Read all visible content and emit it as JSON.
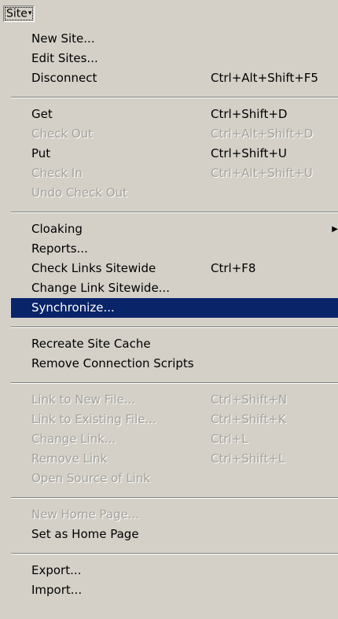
{
  "menu": {
    "title": "Site"
  },
  "items": [
    {
      "label": "New Site...",
      "shortcut": "",
      "enabled": true
    },
    {
      "label": "Edit Sites...",
      "shortcut": "",
      "enabled": true
    },
    {
      "label": "Disconnect",
      "shortcut": "Ctrl+Alt+Shift+F5",
      "enabled": true
    },
    {
      "label": "Get",
      "shortcut": "Ctrl+Shift+D",
      "enabled": true
    },
    {
      "label": "Check Out",
      "shortcut": "Ctrl+Alt+Shift+D",
      "enabled": false
    },
    {
      "label": "Put",
      "shortcut": "Ctrl+Shift+U",
      "enabled": true
    },
    {
      "label": "Check In",
      "shortcut": "Ctrl+Alt+Shift+U",
      "enabled": false
    },
    {
      "label": "Undo Check Out",
      "shortcut": "",
      "enabled": false
    },
    {
      "label": "Cloaking",
      "shortcut": "",
      "enabled": true,
      "submenu": true
    },
    {
      "label": "Reports...",
      "shortcut": "",
      "enabled": true
    },
    {
      "label": "Check Links Sitewide",
      "shortcut": "Ctrl+F8",
      "enabled": true
    },
    {
      "label": "Change Link Sitewide...",
      "shortcut": "",
      "enabled": true
    },
    {
      "label": "Synchronize...",
      "shortcut": "",
      "enabled": true,
      "selected": true
    },
    {
      "label": "Recreate Site Cache",
      "shortcut": "",
      "enabled": true
    },
    {
      "label": "Remove Connection Scripts",
      "shortcut": "",
      "enabled": true
    },
    {
      "label": "Link to New File...",
      "shortcut": "Ctrl+Shift+N",
      "enabled": false
    },
    {
      "label": "Link to Existing File...",
      "shortcut": "Ctrl+Shift+K",
      "enabled": false
    },
    {
      "label": "Change Link...",
      "shortcut": "Ctrl+L",
      "enabled": false
    },
    {
      "label": "Remove Link",
      "shortcut": "Ctrl+Shift+L",
      "enabled": false
    },
    {
      "label": "Open Source of Link",
      "shortcut": "",
      "enabled": false
    },
    {
      "label": "New Home Page...",
      "shortcut": "",
      "enabled": false
    },
    {
      "label": "Set as Home Page",
      "shortcut": "",
      "enabled": true
    },
    {
      "label": "Export...",
      "shortcut": "",
      "enabled": true
    },
    {
      "label": "Import...",
      "shortcut": "",
      "enabled": true
    }
  ],
  "icons": {
    "submenu_arrow": "submenu-arrow-icon",
    "menu_caret": "dropdown-caret-icon"
  },
  "colors": {
    "menu_background": "#d4d0c8",
    "highlight": "#0a246a",
    "disabled_text": "#a3a19b"
  }
}
